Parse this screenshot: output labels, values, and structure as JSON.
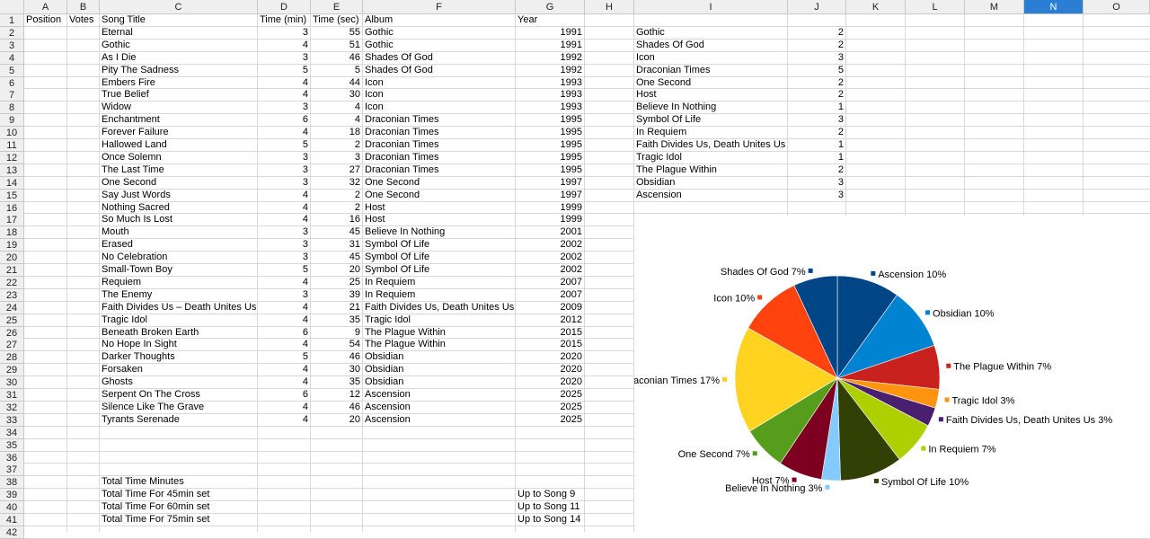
{
  "columns": [
    "A",
    "B",
    "C",
    "D",
    "E",
    "F",
    "G",
    "H",
    "I",
    "J",
    "K",
    "L",
    "M",
    "N",
    "O"
  ],
  "selected_column": "N",
  "headers": {
    "position": "Position",
    "votes": "Votes",
    "song_title": "Song Title",
    "time_min": "Time (min)",
    "time_sec": "Time (sec)",
    "album": "Album",
    "year": "Year"
  },
  "songs": [
    {
      "title": "Eternal",
      "min": "3",
      "sec": "55",
      "album": "Gothic",
      "year": "1991"
    },
    {
      "title": "Gothic",
      "min": "4",
      "sec": "51",
      "album": "Gothic",
      "year": "1991"
    },
    {
      "title": "As I Die",
      "min": "3",
      "sec": "46",
      "album": "Shades Of God",
      "year": "1992"
    },
    {
      "title": "Pity The Sadness",
      "min": "5",
      "sec": "5",
      "album": "Shades Of God",
      "year": "1992"
    },
    {
      "title": "Embers Fire",
      "min": "4",
      "sec": "44",
      "album": "Icon",
      "year": "1993"
    },
    {
      "title": "True Belief",
      "min": "4",
      "sec": "30",
      "album": "Icon",
      "year": "1993"
    },
    {
      "title": "Widow",
      "min": "3",
      "sec": "4",
      "album": "Icon",
      "year": "1993"
    },
    {
      "title": "Enchantment",
      "min": "6",
      "sec": "4",
      "album": "Draconian Times",
      "year": "1995"
    },
    {
      "title": "Forever Failure",
      "min": "4",
      "sec": "18",
      "album": "Draconian Times",
      "year": "1995"
    },
    {
      "title": "Hallowed Land",
      "min": "5",
      "sec": "2",
      "album": "Draconian Times",
      "year": "1995"
    },
    {
      "title": "Once Solemn",
      "min": "3",
      "sec": "3",
      "album": "Draconian Times",
      "year": "1995"
    },
    {
      "title": "The Last Time",
      "min": "3",
      "sec": "27",
      "album": "Draconian Times",
      "year": "1995"
    },
    {
      "title": "One Second",
      "min": "3",
      "sec": "32",
      "album": "One Second",
      "year": "1997"
    },
    {
      "title": "Say Just Words",
      "min": "4",
      "sec": "2",
      "album": "One Second",
      "year": "1997"
    },
    {
      "title": "Nothing Sacred",
      "min": "4",
      "sec": "2",
      "album": "Host",
      "year": "1999"
    },
    {
      "title": "So Much Is Lost",
      "min": "4",
      "sec": "16",
      "album": "Host",
      "year": "1999"
    },
    {
      "title": "Mouth",
      "min": "3",
      "sec": "45",
      "album": "Believe In Nothing",
      "year": "2001"
    },
    {
      "title": "Erased",
      "min": "3",
      "sec": "31",
      "album": "Symbol Of Life",
      "year": "2002"
    },
    {
      "title": "No Celebration",
      "min": "3",
      "sec": "45",
      "album": "Symbol Of Life",
      "year": "2002"
    },
    {
      "title": "Small-Town Boy",
      "min": "5",
      "sec": "20",
      "album": "Symbol Of Life",
      "year": "2002"
    },
    {
      "title": "Requiem",
      "min": "4",
      "sec": "25",
      "album": "In Requiem",
      "year": "2007"
    },
    {
      "title": "The Enemy",
      "min": "3",
      "sec": "39",
      "album": "In Requiem",
      "year": "2007"
    },
    {
      "title": "Faith Divides Us – Death Unites Us",
      "min": "4",
      "sec": "21",
      "album": "Faith Divides Us, Death Unites Us",
      "year": "2009"
    },
    {
      "title": "Tragic Idol",
      "min": "4",
      "sec": "35",
      "album": "Tragic Idol",
      "year": "2012"
    },
    {
      "title": "Beneath Broken Earth",
      "min": "6",
      "sec": "9",
      "album": "The Plague Within",
      "year": "2015"
    },
    {
      "title": "No Hope In Sight",
      "min": "4",
      "sec": "54",
      "album": "The Plague Within",
      "year": "2015"
    },
    {
      "title": "Darker Thoughts",
      "min": "5",
      "sec": "46",
      "album": "Obsidian",
      "year": "2020"
    },
    {
      "title": "Forsaken",
      "min": "4",
      "sec": "30",
      "album": "Obsidian",
      "year": "2020"
    },
    {
      "title": "Ghosts",
      "min": "4",
      "sec": "35",
      "album": "Obsidian",
      "year": "2020"
    },
    {
      "title": "Serpent On The Cross",
      "min": "6",
      "sec": "12",
      "album": "Ascension",
      "year": "2025"
    },
    {
      "title": "Silence Like The Grave",
      "min": "4",
      "sec": "46",
      "album": "Ascension",
      "year": "2025"
    },
    {
      "title": "Tyrants Serenade",
      "min": "4",
      "sec": "20",
      "album": "Ascension",
      "year": "2025"
    }
  ],
  "album_counts": [
    {
      "album": "Gothic",
      "count": "2"
    },
    {
      "album": "Shades Of God",
      "count": "2"
    },
    {
      "album": "Icon",
      "count": "3"
    },
    {
      "album": "Draconian Times",
      "count": "5"
    },
    {
      "album": "One Second",
      "count": "2"
    },
    {
      "album": "Host",
      "count": "2"
    },
    {
      "album": "Believe In Nothing",
      "count": "1"
    },
    {
      "album": "Symbol Of Life",
      "count": "3"
    },
    {
      "album": "In Requiem",
      "count": "2"
    },
    {
      "album": "Faith Divides Us, Death Unites Us",
      "count": "1"
    },
    {
      "album": "Tragic Idol",
      "count": "1"
    },
    {
      "album": "The Plague Within",
      "count": "2"
    },
    {
      "album": "Obsidian",
      "count": "3"
    },
    {
      "album": "Ascension",
      "count": "3"
    }
  ],
  "totals": [
    {
      "label": "Total Time Minutes",
      "value": ""
    },
    {
      "label": "Total Time For 45min set",
      "value": "Up to Song 9"
    },
    {
      "label": "Total Time For 60min set",
      "value": "Up to Song 11"
    },
    {
      "label": "Total Time For 75min set",
      "value": "Up to Song 14"
    }
  ],
  "chart_data": {
    "type": "pie",
    "title": "",
    "legend": "none",
    "slices": [
      {
        "name": "Ascension",
        "pct": 10,
        "label": "Ascension 10%",
        "color": "#004586"
      },
      {
        "name": "Obsidian",
        "pct": 10,
        "label": "Obsidian 10%",
        "color": "#0084d1"
      },
      {
        "name": "The Plague Within",
        "pct": 7,
        "label": "The Plague Within 7%",
        "color": "#c9211e"
      },
      {
        "name": "Tragic Idol",
        "pct": 3,
        "label": "Tragic Idol 3%",
        "color": "#ff950e"
      },
      {
        "name": "Faith Divides Us, Death Unites Us",
        "pct": 3,
        "label": "Faith Divides Us, Death Unites Us 3%",
        "color": "#4b1f6f"
      },
      {
        "name": "In Requiem",
        "pct": 7,
        "label": "In Requiem 7%",
        "color": "#aecf00"
      },
      {
        "name": "Symbol Of Life",
        "pct": 10,
        "label": "Symbol Of Life 10%",
        "color": "#314004"
      },
      {
        "name": "Believe In Nothing",
        "pct": 3,
        "label": "Believe In Nothing 3%",
        "color": "#83caff"
      },
      {
        "name": "Host",
        "pct": 7,
        "label": "Host 7%",
        "color": "#7e0021"
      },
      {
        "name": "One Second",
        "pct": 7,
        "label": "One Second 7%",
        "color": "#579d1c"
      },
      {
        "name": "Draconian Times",
        "pct": 17,
        "label": "Draconian Times 17%",
        "color": "#ffd320"
      },
      {
        "name": "Icon",
        "pct": 10,
        "label": "Icon 10%",
        "color": "#ff420e"
      },
      {
        "name": "Shades Of God",
        "pct": 7,
        "label": "Shades Of God 7%",
        "color": "#004586"
      }
    ]
  }
}
